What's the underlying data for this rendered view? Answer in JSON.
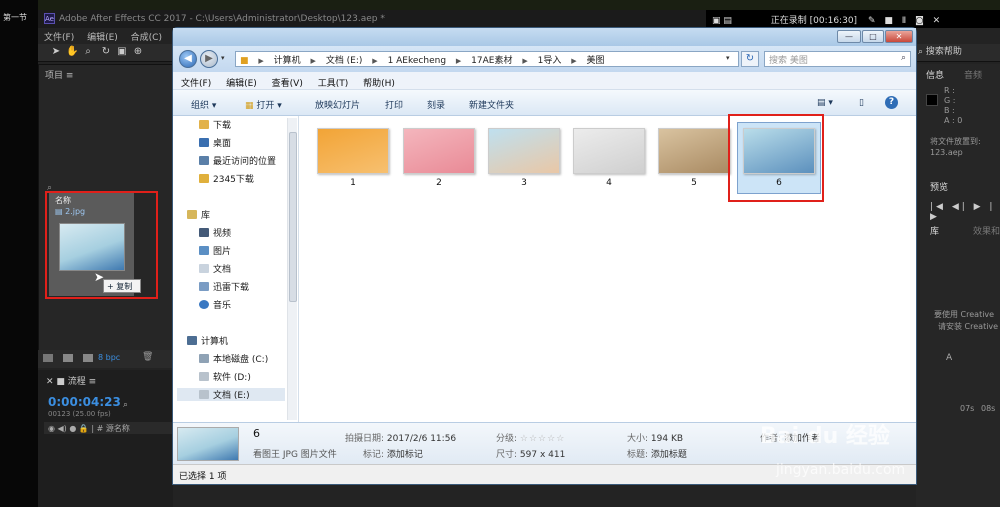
{
  "video": {
    "episode_label": "第一节"
  },
  "recording": {
    "text": "正在录制 [00:16:30]"
  },
  "ae": {
    "title": "Adobe After Effects CC 2017 - C:\\Users\\Administrator\\Desktop\\123.aep *",
    "menu": [
      "文件(F)",
      "编辑(E)",
      "合成(C)"
    ],
    "project_panel_title": "项目",
    "project_col_name": "名称",
    "drag_file_name": "2.jpg",
    "bpc": "8 bpc",
    "timeline_tab": "流程",
    "timecode": "0:00:04:23",
    "timecode_sub": "00123 (25.00 fps)",
    "source_name_col": "源名称",
    "search_help": "搜索帮助",
    "info_tab": "信息",
    "audio_tab": "音频",
    "info_rgb": [
      "R :",
      "G :",
      "B :",
      "A : 0"
    ],
    "info_moved": "将文件放置到:",
    "info_file": "123.aep",
    "preview_tab": "预览",
    "library_tab": "库",
    "effects_tab": "效果和",
    "library_msg1": "要使用 Creative",
    "library_msg2": "请安装 Creative",
    "ruler_07s": "07s",
    "ruler_08s": "08s",
    "copy_tooltip": "复制"
  },
  "explorer": {
    "address": [
      "计算机",
      "文档 (E:)",
      "1 AEkecheng",
      "17AE素材",
      "1导入",
      "美图"
    ],
    "search_placeholder": "搜索 美图",
    "menu": [
      "文件(F)",
      "编辑(E)",
      "查看(V)",
      "工具(T)",
      "帮助(H)"
    ],
    "commands": [
      "组织 ▾",
      "打开 ▾",
      "放映幻灯片",
      "打印",
      "刻录",
      "新建文件夹"
    ],
    "nav": {
      "favorites": [
        "下载",
        "桌面",
        "最近访问的位置",
        "2345下载"
      ],
      "library_header": "库",
      "libraries": [
        "视频",
        "图片",
        "文档",
        "迅雷下载",
        "音乐"
      ],
      "computer_header": "计算机",
      "drives": [
        "本地磁盘 (C:)",
        "软件 (D:)",
        "文档 (E:)"
      ]
    },
    "files": [
      {
        "name": "1",
        "color_a": "#f2a436",
        "color_b": "#f7c070"
      },
      {
        "name": "2",
        "color_a": "#f4b6bd",
        "color_b": "#e98a96"
      },
      {
        "name": "3",
        "color_a": "#bfe0ef",
        "color_b": "#e9c7a6"
      },
      {
        "name": "4",
        "color_a": "#ececec",
        "color_b": "#cfcfcf"
      },
      {
        "name": "5",
        "color_a": "#d9c3a0",
        "color_b": "#a98a62"
      },
      {
        "name": "6",
        "color_a": "#b9ddea",
        "color_b": "#5c90bd",
        "selected": true
      }
    ],
    "details": {
      "name": "6",
      "type": "看图王 JPG 图片文件",
      "date_label": "拍摄日期:",
      "date": "2017/2/6 11:56",
      "tags_label": "标记:",
      "tags": "添加标记",
      "rating_label": "分级:",
      "rating_stars": "☆☆☆☆☆",
      "dims_label": "尺寸:",
      "dims": "597 x 411",
      "size_label": "大小:",
      "size": "194 KB",
      "title_label": "标题:",
      "title": "添加标题",
      "author_label": "作者:",
      "author": "添加作者"
    },
    "status": "已选择 1 项"
  },
  "watermark": {
    "brand": "Bai du 经验",
    "url": "jingyan.baidu.com"
  }
}
